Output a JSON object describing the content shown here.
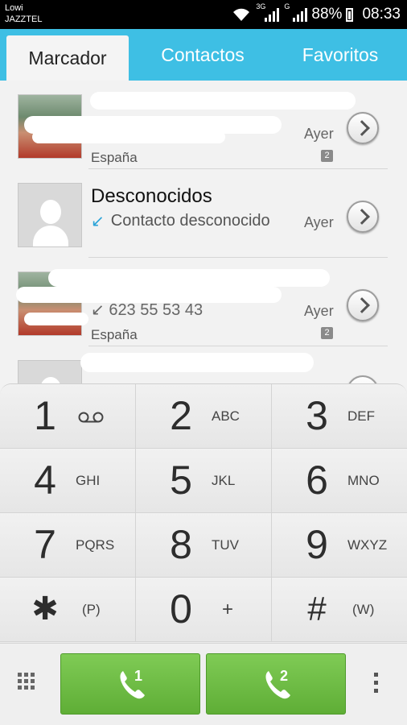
{
  "status_bar": {
    "carrier_1": "Lowi",
    "carrier_2": "JAZZTEL",
    "network_1": "3G",
    "network_2": "G",
    "battery": "88%",
    "time": "08:33"
  },
  "tabs": [
    {
      "label": "Marcador",
      "active": true
    },
    {
      "label": "Contactos",
      "active": false
    },
    {
      "label": "Favoritos",
      "active": false
    }
  ],
  "call_log": [
    {
      "name": "",
      "number": "",
      "day": "Ayer",
      "country": "España",
      "count": "2",
      "avatar": "photo"
    },
    {
      "name": "Desconocidos",
      "subtitle": "Contacto desconocido",
      "day": "Ayer",
      "avatar": "placeholder",
      "call_type_icon": "missed-call-arrow-icon"
    },
    {
      "name": "",
      "number": "↙ 623 55 53 43",
      "day": "Ayer",
      "country": "España",
      "count": "2",
      "avatar": "photo"
    },
    {
      "name": "",
      "avatar": "placeholder"
    }
  ],
  "keypad": [
    {
      "digit": "1",
      "letters": "",
      "icon": "voicemail-icon"
    },
    {
      "digit": "2",
      "letters": "ABC"
    },
    {
      "digit": "3",
      "letters": "DEF"
    },
    {
      "digit": "4",
      "letters": "GHI"
    },
    {
      "digit": "5",
      "letters": "JKL"
    },
    {
      "digit": "6",
      "letters": "MNO"
    },
    {
      "digit": "7",
      "letters": "PQRS"
    },
    {
      "digit": "8",
      "letters": "TUV"
    },
    {
      "digit": "9",
      "letters": "WXYZ"
    },
    {
      "digit": "✱",
      "letters": "(P)"
    },
    {
      "digit": "0",
      "letters": "+"
    },
    {
      "digit": "#",
      "letters": "(W)"
    }
  ],
  "actions": {
    "sim1_label": "1",
    "sim2_label": "2"
  },
  "colors": {
    "tab_bar": "#3ebfe4",
    "call_button": "#6ebc44",
    "missed_arrow": "#2aa3d8"
  }
}
